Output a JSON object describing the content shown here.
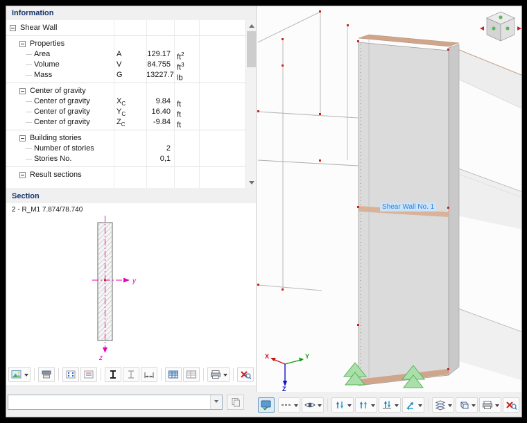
{
  "info": {
    "title": "Information",
    "root": "Shear Wall",
    "groups": [
      {
        "label": "Properties",
        "rows": [
          {
            "name": "Area",
            "symbol": "A",
            "value": "129.17",
            "unit": "ft",
            "unit_sup": "2"
          },
          {
            "name": "Volume",
            "symbol": "V",
            "value": "84.755",
            "unit": "ft",
            "unit_sup": "3"
          },
          {
            "name": "Mass",
            "symbol": "G",
            "value": "13227.7",
            "unit": "lb"
          }
        ]
      },
      {
        "label": "Center of gravity",
        "rows": [
          {
            "name": "Center of gravity",
            "symbol": "X",
            "symbol_sub": "C",
            "value": "9.84",
            "unit": "ft"
          },
          {
            "name": "Center of gravity",
            "symbol": "Y",
            "symbol_sub": "C",
            "value": "16.40",
            "unit": "ft"
          },
          {
            "name": "Center of gravity",
            "symbol": "Z",
            "symbol_sub": "C",
            "value": "-9.84",
            "unit": "ft"
          }
        ]
      },
      {
        "label": "Building stories",
        "rows": [
          {
            "name": "Number of stories",
            "value": "2"
          },
          {
            "name": "Stories No.",
            "value": "0,1"
          }
        ]
      },
      {
        "label": "Result sections",
        "rows": []
      }
    ]
  },
  "section": {
    "title": "Section",
    "label": "2 - R_M1 7.874/78.740",
    "axis_y": "y",
    "axis_z": "z"
  },
  "viewport": {
    "wall_label": "Shear Wall No. 1",
    "axis_x": "X",
    "axis_y": "Y",
    "axis_z": "Z"
  },
  "statusbar": {
    "combo_value": ""
  },
  "colors": {
    "title_navy": "#17356d",
    "section_axis_magenta": "#e606b8",
    "axis_x_red": "#cc1111",
    "axis_y_green": "#119911",
    "axis_z_blue": "#1111cc",
    "support_green": "#aadfaa",
    "wall_top_tan": "#cfa68b",
    "label_blue": "#2f80d0",
    "node_red": "#cc2222"
  },
  "icons": {
    "collapse_box": "minus-in-square",
    "dropdown_arrow": "filled-down-triangle",
    "close_cross": "red X",
    "eye": "eye outline",
    "printer": "printer",
    "table": "grid table",
    "magnifier": "magnifying glass"
  }
}
